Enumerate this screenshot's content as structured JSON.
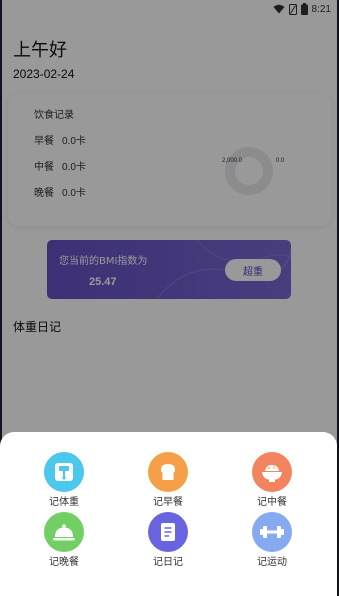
{
  "status_bar": {
    "time": "8:21",
    "icons": [
      "wifi-icon",
      "sim-icon",
      "battery-icon"
    ]
  },
  "home": {
    "greeting": "上午好",
    "date": "2023-02-24",
    "diet_card": {
      "title": "饮食记录",
      "meals": [
        {
          "name": "早餐",
          "value": "0.0卡"
        },
        {
          "name": "中餐",
          "value": "0.0卡"
        },
        {
          "name": "晚餐",
          "value": "0.0卡"
        }
      ],
      "donut_left_label": "2,000.0",
      "donut_right_label": "0.0"
    },
    "bmi_card": {
      "label": "您当前的BMI指数为",
      "value": "25.47",
      "status": "超重"
    },
    "weight_diary_title": "体重日记"
  },
  "sheet": {
    "actions": [
      {
        "label": "记体重",
        "icon": "scale-icon",
        "color": "#4cc8ee"
      },
      {
        "label": "记早餐",
        "icon": "bread-icon",
        "color": "#f5a048"
      },
      {
        "label": "记中餐",
        "icon": "rice-bowl-icon",
        "color": "#f2855f"
      },
      {
        "label": "记晚餐",
        "icon": "cloche-icon",
        "color": "#72cf63"
      },
      {
        "label": "记日记",
        "icon": "notebook-icon",
        "color": "#6a63e0"
      },
      {
        "label": "记运动",
        "icon": "dumbbell-icon",
        "color": "#86aaf0"
      }
    ]
  },
  "colors": {
    "bmi_gradient_start": "#6750c4",
    "bmi_gradient_end": "#7868d2",
    "overlay": "rgba(0,0,0,0.4)"
  }
}
